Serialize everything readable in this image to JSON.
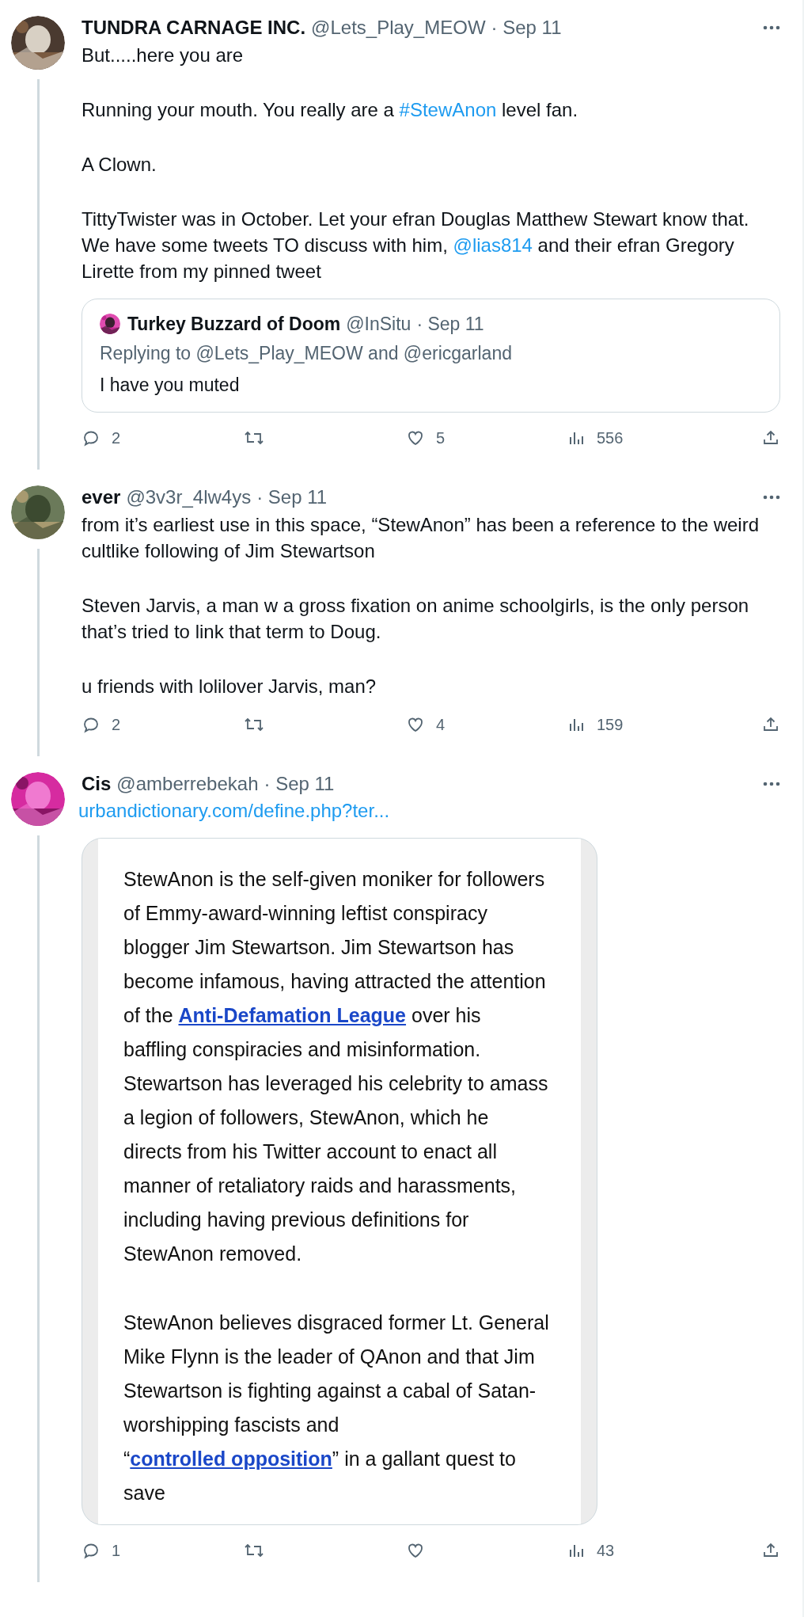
{
  "tweets": [
    {
      "name": "TUNDRA CARNAGE INC.",
      "handle": "@Lets_Play_MEOW",
      "date": "· Sep 11",
      "body": [
        [
          {
            "kind": "text",
            "text": "But.....here you are"
          }
        ],
        [
          {
            "kind": "text",
            "text": "Running your mouth. You really are a "
          },
          {
            "kind": "hashtag",
            "text": "#StewAnon"
          },
          {
            "kind": "text",
            "text": " level fan."
          }
        ],
        [
          {
            "kind": "text",
            "text": "A Clown."
          }
        ],
        [
          {
            "kind": "text",
            "text": "TittyTwister was in October. Let your efran Douglas Matthew Stewart know that. We have some tweets TO discuss with him, "
          },
          {
            "kind": "mention",
            "text": "@lias814"
          },
          {
            "kind": "text",
            "text": " and their efran Gregory Lirette from my pinned tweet"
          }
        ]
      ],
      "quote": {
        "name": "Turkey Buzzard of Doom",
        "handle": "@InSitu",
        "date": "· Sep 11",
        "replying": "Replying to @Lets_Play_MEOW and @ericgarland",
        "text": "I have you muted"
      },
      "actions": {
        "replies": "2",
        "likes": "5",
        "views": "556"
      }
    },
    {
      "name": "ever",
      "handle": "@3v3r_4lw4ys",
      "date": "· Sep 11",
      "body": [
        [
          {
            "kind": "text",
            "text": "from it’s earliest use in this space, “StewAnon” has been a reference to the weird cultlike following of Jim Stewartson"
          }
        ],
        [
          {
            "kind": "text",
            "text": "Steven Jarvis, a man w a gross fixation on anime schoolgirls, is the only person that’s tried to link that term to Doug."
          }
        ],
        [
          {
            "kind": "text",
            "text": "u friends with lolilover Jarvis, man?"
          }
        ]
      ],
      "actions": {
        "replies": "2",
        "likes": "4",
        "views": "159"
      }
    },
    {
      "name": "Cis",
      "handle": "@amberrebekah",
      "date": "· Sep 11",
      "link": "urbandictionary.com/define.php?ter...",
      "card": [
        [
          {
            "kind": "text",
            "text": "StewAnon is the self-given moniker for followers of Emmy-award-winning leftist conspiracy blogger Jim Stewartson. Jim Stewartson has become infamous, having attracted the attention of the "
          },
          {
            "kind": "link",
            "text": "Anti-Defamation League"
          },
          {
            "kind": "text",
            "text": " over his baffling conspiracies and misinformation. Stewartson has leveraged his celebrity to amass a legion of followers, StewAnon, which he directs from his Twitter account to enact all manner of retaliatory raids and harassments, including having previous definitions for StewAnon removed."
          }
        ],
        [
          {
            "kind": "text",
            "text": "StewAnon believes disgraced former Lt. General Mike Flynn is the leader of QAnon and that Jim Stewartson is fighting against a cabal of Satan-worshipping fascists and “"
          },
          {
            "kind": "link",
            "text": "controlled opposition"
          },
          {
            "kind": "text",
            "text": "” in a gallant quest to save"
          }
        ]
      ],
      "actions": {
        "replies": "1",
        "views": "43"
      }
    }
  ]
}
